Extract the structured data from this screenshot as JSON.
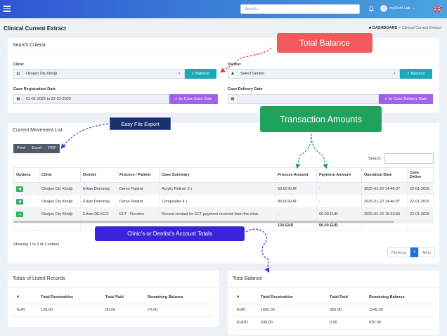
{
  "topbar": {
    "search_placeholder": "Search...",
    "user": "myDent Lab",
    "caret": "⌄",
    "flag_icon": "uk-flag"
  },
  "page": {
    "title": "Clinical Current Extract",
    "crumb_home": "DASHBOARD",
    "crumb_sep": ">",
    "crumb_current": "Clinical Current Extract"
  },
  "search": {
    "title": "Search Criteria",
    "clinic_label": "Clinic",
    "clinic_value": "Oksijen Diş Kliniği",
    "clinic_btn": "Balance",
    "dentist_label": "Dentist",
    "dentist_value": "Select Dentist",
    "dentist_btn": "Balance",
    "reg_label": "Case Registration Date",
    "reg_value": "01-01-2025 to 22-01-2025",
    "reg_btn": "by Case Save Date",
    "del_label": "Case Delivery Date",
    "del_value": "",
    "del_btn": "by Case Delivery Date"
  },
  "movement": {
    "title": "Current Movement List",
    "export": [
      "Print",
      "Excel",
      "PDF"
    ],
    "search_label": "Search:",
    "columns": [
      "Options",
      "Clinic",
      "Dentist",
      "Process / Patient",
      "Case Summary",
      "Process Amount",
      "Payment Amount",
      "Operation Date",
      "Case Delive"
    ],
    "rows": [
      {
        "btn": "◀",
        "btn_color": "#2fb56a",
        "clinic": "Oksijen Diş Kliniği",
        "dentist": "Erkan Demirtaş",
        "patient": "Demo Patient",
        "summary": "Acrylic Reline( 5 )",
        "process": "50.00 EUR",
        "payment": "-",
        "date": "2025-01-22 14:46:07",
        "delivery": "22-01-2025"
      },
      {
        "btn": "◀",
        "btn_color": "#2fb56a",
        "clinic": "Oksijen Diş Kliniği",
        "dentist": "Erkan Demirtaş",
        "patient": "Demo Patient",
        "summary": "Composite( 4 )",
        "process": "80.00 EUR",
        "payment": "-",
        "date": "2025-01-22 14:46:07",
        "delivery": "22-01-2025"
      },
      {
        "btn": "➜",
        "btn_color": "#2fb56a",
        "clinic": "Oksijen Diş Kliniği",
        "dentist": "Erhan DEVECİ",
        "patient": "EFT - Receive",
        "summary": "Record created for EFT payment received from the clinic.",
        "process": "-",
        "payment": "60.00 EUR",
        "date": "2025-01-22 15:33:00",
        "delivery": "22-01-2025"
      }
    ],
    "totals": {
      "process": "130 EUR",
      "payment": "60.00 EUR"
    },
    "info": "Showing 1 to 3 of 3 entries",
    "pager": {
      "prev": "Previous",
      "page": "1",
      "next": "Next"
    }
  },
  "listed": {
    "title": "Totals of Listed Records",
    "columns": [
      "#",
      "Total Receivables",
      "Total Paid",
      "Remaining Balance"
    ],
    "rows": [
      [
        "EUR",
        "130.00",
        "60.00",
        "70.00"
      ]
    ]
  },
  "balance": {
    "title": "Total Balance",
    "columns": [
      "#",
      "Total Receivables",
      "Total Paid",
      "Remaining Balance"
    ],
    "rows": [
      [
        "EUR",
        "1605.00",
        "360.00",
        "1245.00"
      ],
      [
        "EURO",
        "630.00",
        "0.00",
        "630.00"
      ]
    ]
  },
  "callouts": {
    "total_balance": "Total Balance",
    "easy_export": "Easy File Export",
    "transaction_amounts": "Transaction Amounts",
    "account_totals": "Clinic's or Dentist's Account Totals"
  },
  "colors": {
    "topbar": "#3a7bd5",
    "teal": "#1ba8b8",
    "purple": "#a160e8",
    "red_callout": "#f05a5a",
    "green_callout": "#1fa35c",
    "blue_callout": "#3a24d8",
    "navy_callout": "#1a2f6e"
  }
}
